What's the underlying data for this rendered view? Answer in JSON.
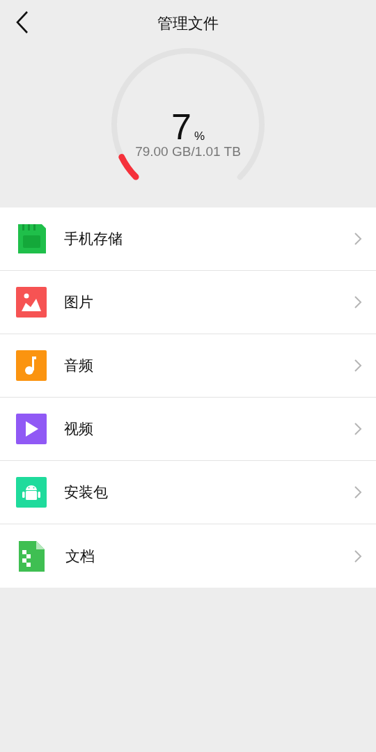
{
  "header": {
    "title": "管理文件"
  },
  "storage": {
    "percent": "7",
    "unit": "%",
    "usage": "79.00 GB/1.01 TB",
    "level": 0.07
  },
  "items": [
    {
      "kind": "sd",
      "label": "手机存储"
    },
    {
      "kind": "image",
      "label": "图片"
    },
    {
      "kind": "audio",
      "label": "音频"
    },
    {
      "kind": "video",
      "label": "视频"
    },
    {
      "kind": "apk",
      "label": "安装包"
    },
    {
      "kind": "doc",
      "label": "文档"
    }
  ]
}
